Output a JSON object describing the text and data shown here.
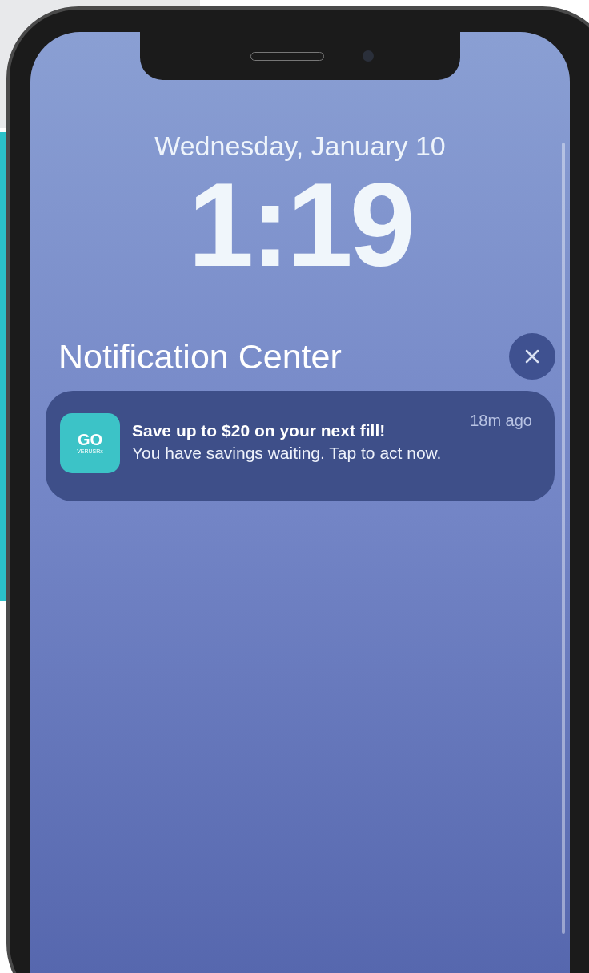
{
  "lock_screen": {
    "date": "Wednesday, January 10",
    "time": "1:19"
  },
  "notification_center": {
    "title": "Notification Center"
  },
  "notifications": [
    {
      "app_logo": {
        "mark": "GO",
        "wordmark": "VERUSRx"
      },
      "title": "Save up to $20 on your next fill!",
      "body": "You have savings waiting. Tap to act now.",
      "time": "18m ago"
    }
  ]
}
